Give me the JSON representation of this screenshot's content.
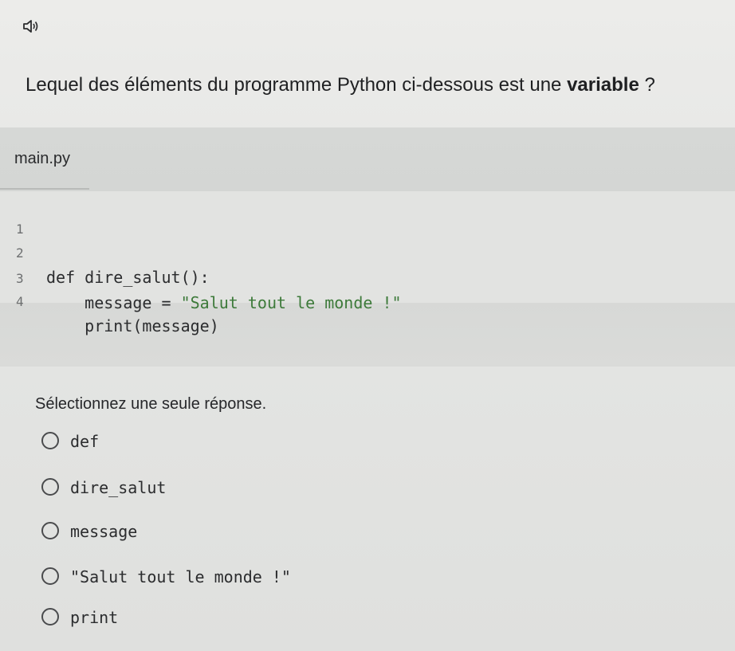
{
  "question": {
    "prefix": "Lequel des éléments du programme Python ci-dessous est une ",
    "emphasis": "variable",
    "suffix": " ?"
  },
  "editor": {
    "file_name": "main.py",
    "lines": [
      {
        "number": "1",
        "code_a": "",
        "code_b": ""
      },
      {
        "number": "2",
        "code_a": "def dire_salut():",
        "code_b": ""
      },
      {
        "number": "3",
        "code_a": "    message = ",
        "code_b": "\"Salut tout le monde !\""
      },
      {
        "number": "4",
        "code_a": "    print(message)",
        "code_b": ""
      }
    ]
  },
  "instruction": "Sélectionnez une seule réponse.",
  "options": [
    {
      "label": "def",
      "selected": false
    },
    {
      "label": "dire_salut",
      "selected": false
    },
    {
      "label": "message",
      "selected": false
    },
    {
      "label": "\"Salut tout le monde !\"",
      "selected": false
    },
    {
      "label": "print",
      "selected": false
    }
  ],
  "icons": {
    "audio": "speaker-icon"
  },
  "colors": {
    "string_literal": "#3d7a3a",
    "background": "#e6e7e5"
  }
}
